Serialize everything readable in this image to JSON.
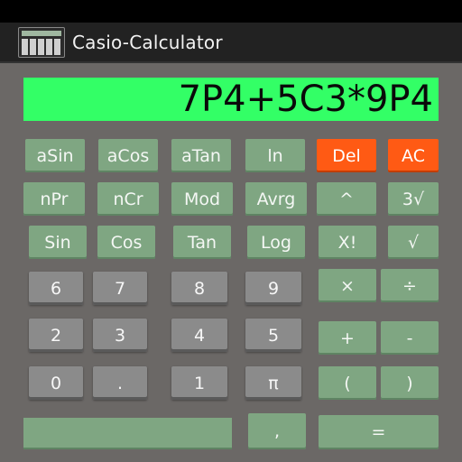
{
  "app": {
    "title": "Casio-Calculator"
  },
  "display": {
    "expression": "7P4+5C3*9P4"
  },
  "buttons": {
    "asin": "aSin",
    "acos": "aCos",
    "atan": "aTan",
    "ln": "ln",
    "del": "Del",
    "ac": "AC",
    "npr": "nPr",
    "ncr": "nCr",
    "mod": "Mod",
    "avrg": "Avrg",
    "pow": "^",
    "cbrt": "3√",
    "sin": "Sin",
    "cos": "Cos",
    "tan": "Tan",
    "log": "Log",
    "fact": "X!",
    "sqrt": "√",
    "d7": "7",
    "d8": "8",
    "d9": "9",
    "d6": "6",
    "mul": "×",
    "div": "÷",
    "d2": "2",
    "d3": "3",
    "d4": "4",
    "d5": "5",
    "plus": "+",
    "minus": "-",
    "d0": "0",
    "dot": ".",
    "d1": "1",
    "pi": "π",
    "lparen": "(",
    "rparen": ")",
    "comma": ",",
    "equals": "="
  },
  "colors": {
    "display": "#33ff66",
    "function_key": "#7fa682",
    "digit_key": "#8b8b8b",
    "clear_key": "#ff5a14"
  }
}
